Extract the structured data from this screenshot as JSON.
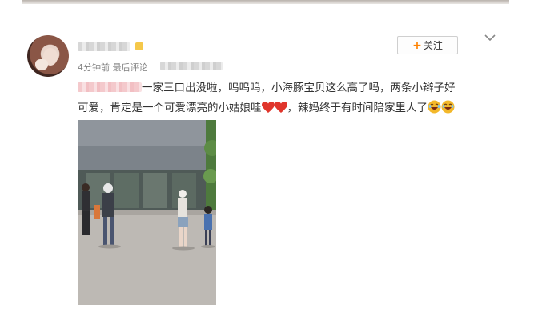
{
  "post": {
    "meta": "4分钟前 最后评论",
    "text_line1": "一家三口出没啦，呜呜呜，小海豚宝贝这么高了吗，两条小辫子好",
    "text_line2a": "可爱，肯定是一个可爱漂亮的小姑娘哇",
    "text_line2b": "，辣妈终于有时间陪家里人了",
    "follow_label": "关注",
    "follow_icon": "plus-icon",
    "more_icon": "chevron-down-icon",
    "emojis": [
      "heart-icon",
      "heart-icon",
      "laugh-icon",
      "laugh-icon"
    ],
    "image": "street-photo-family"
  },
  "colors": {
    "follow_plus": "#ff8200",
    "text": "#333333",
    "meta": "#808080",
    "heart": "#e0352b",
    "laugh": "#f3b82a"
  }
}
